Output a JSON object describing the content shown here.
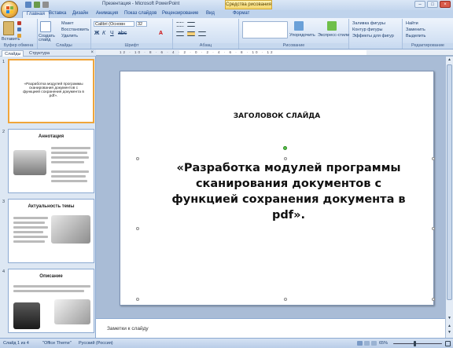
{
  "window": {
    "title": "Презентация - Microsoft PowerPoint",
    "context_tab": "Средства рисования",
    "buttons": [
      "–",
      "□",
      "×"
    ]
  },
  "tabs": [
    {
      "label": "Главная",
      "active": true
    },
    {
      "label": "Вставка"
    },
    {
      "label": "Дизайн"
    },
    {
      "label": "Анимация"
    },
    {
      "label": "Показ слайдов"
    },
    {
      "label": "Рецензирование"
    },
    {
      "label": "Вид"
    },
    {
      "label": "Формат"
    }
  ],
  "ribbon": {
    "clipboard": {
      "paste": "Вставить",
      "cut": "Вырезать",
      "copy": "Копировать",
      "format": "Формат",
      "label": "Буфер обмена"
    },
    "slides": {
      "new_slide": "Создать слайд",
      "layout": "Макет",
      "reset": "Восстановить",
      "delete": "Удалить",
      "label": "Слайды"
    },
    "font": {
      "name": "Calibri (Основн",
      "size": "32",
      "label": "Шрифт"
    },
    "paragraph": {
      "label": "Абзац"
    },
    "drawing": {
      "arrange": "Упорядочить",
      "quick_styles": "Экспресс-стили",
      "label": "Рисование"
    },
    "shape_fill": "Заливка фигуры",
    "shape_outline": "Контур фигуры",
    "shape_effects": "Эффекты для фигур",
    "editing": {
      "find": "Найти",
      "replace": "Заменить",
      "select": "Выделить",
      "label": "Редактирование"
    }
  },
  "ruler_ticks": "12 · 10 · 8 · 6 · 4 · 2 · 0 · 2 · 4 · 6 · 8 · 10 · 12",
  "panel": {
    "tab_slides": "Слайды",
    "tab_outline": "Структура",
    "slides": [
      {
        "num": "1",
        "title": "«Разработка модулей программы сканирования документов с функцией сохранения документа в pdf».",
        "selected": true
      },
      {
        "num": "2",
        "title": "Аннотация"
      },
      {
        "num": "3",
        "title": "Актуальность темы"
      },
      {
        "num": "4",
        "title": "Описание"
      }
    ]
  },
  "slide": {
    "title": "ЗАГОЛОВОК СЛАЙДА",
    "body": "«Разработка модулей  программы сканирования документов с функцией сохранения документа в pdf»."
  },
  "notes_placeholder": "Заметки к слайду",
  "status": {
    "slide": "Слайд 1 из 4",
    "theme": "\"Office Theme\"",
    "language": "Русский (Россия)",
    "zoom": "65%"
  },
  "colors": {
    "accent": "#f0a53a",
    "ribbon": "#d4e2f4",
    "frame": "#8ba9d1"
  }
}
